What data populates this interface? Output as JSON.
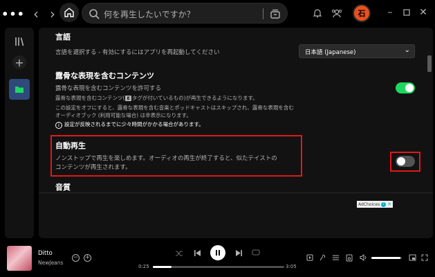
{
  "search": {
    "placeholder": "何を再生したいですか？"
  },
  "user": {
    "avatar_initial": "石"
  },
  "settings": {
    "language": {
      "heading": "言語",
      "description": "言語を選択する - 有効にするにはアプリを再起動してください",
      "selected": "日本語 (Japanese)"
    },
    "explicit": {
      "heading": "露骨な表現を含むコンテンツ",
      "allow_label": "露骨な表現を含むコンテンツを許可する",
      "tag_line_before": "露骨な表現を含むコンテンツ(",
      "tag_badge": "E",
      "tag_line_after": "タグが付いているもの)が再生できるようになります。",
      "off_line1": "この設定をオフにすると、露骨な表現を含む音楽とポッドキャストはスキップされ、露骨な表現を含む",
      "off_line2": "オーディオブック (利用可能な場合) は非表示になります。",
      "note": "設定が反映されるまでに少々時間がかかる場合があります。",
      "enabled": true
    },
    "autoplay": {
      "heading": "自動再生",
      "desc_line1": "ノンストップで再生を楽しめます。オーディオの再生が終了すると、似たテイストの",
      "desc_line2": "コンテンツが再生されます。",
      "enabled": false
    },
    "quality": {
      "heading": "音質"
    }
  },
  "ad": {
    "label": "AdChoices"
  },
  "player": {
    "title": "Ditto",
    "artist": "NewJeans",
    "elapsed": "0:25",
    "duration": "3:05",
    "progress": 0.14,
    "volume": 0.95
  },
  "colors": {
    "accent": "#1ed760",
    "highlight": "#e31818",
    "avatar": "#e8501e"
  }
}
